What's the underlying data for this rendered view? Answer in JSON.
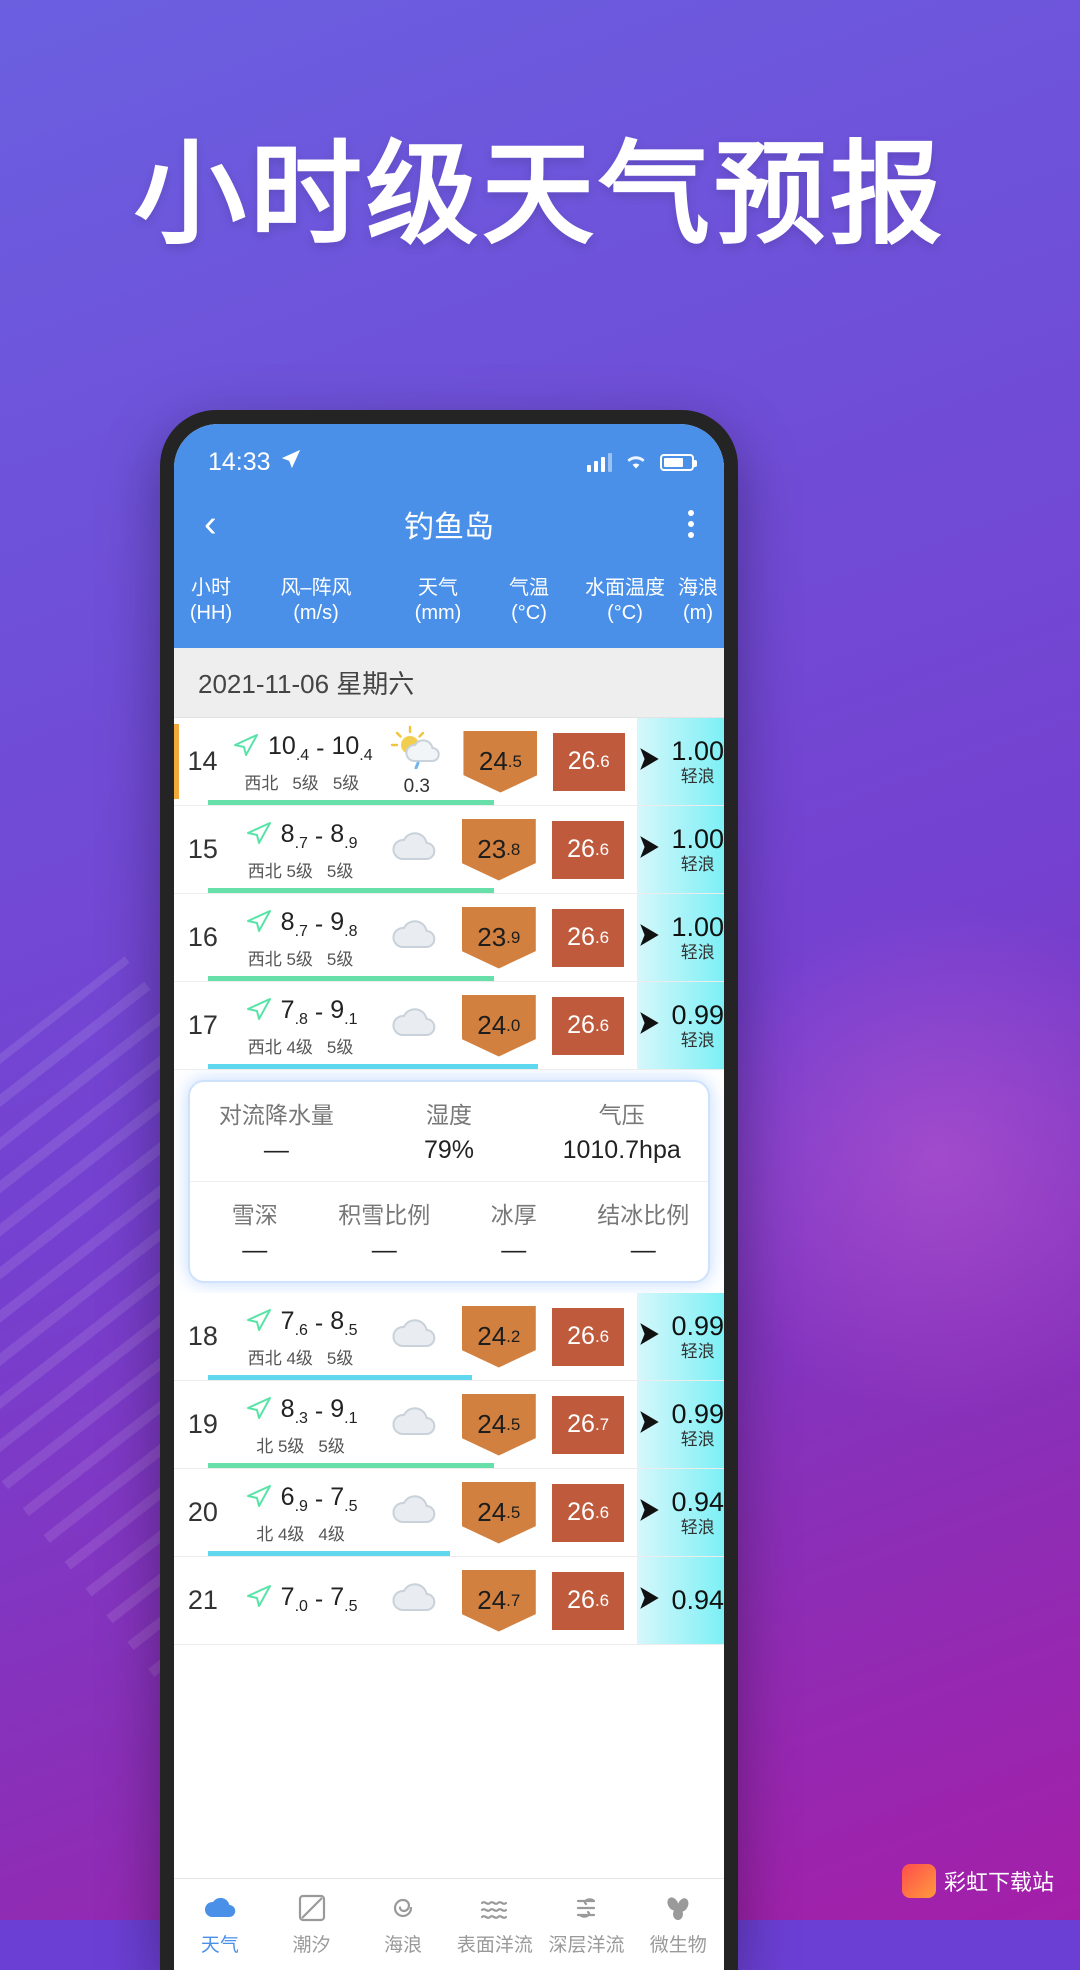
{
  "promo": {
    "headline": "小时级天气预报"
  },
  "watermark": {
    "text": "彩虹下载站",
    "logo": "rainbow-logo-icon"
  },
  "statusbar": {
    "time": "14:33",
    "location_icon": "navigation-arrow-icon",
    "signal_icon": "signal-bars-icon",
    "wifi_icon": "wifi-icon",
    "battery_icon": "battery-icon"
  },
  "appbar": {
    "back_icon": "chevron-left-icon",
    "title": "钓鱼岛",
    "menu_icon": "kebab-menu-icon"
  },
  "columns": [
    {
      "name": "小时",
      "unit": "(HH)"
    },
    {
      "name": "风–阵风",
      "unit": "(m/s)"
    },
    {
      "name": "天气",
      "unit": "(mm)"
    },
    {
      "name": "气温",
      "unit": "(°C)"
    },
    {
      "name": "水面温度",
      "unit": "(°C)"
    },
    {
      "name": "海浪",
      "unit": "(m)"
    }
  ],
  "day_header": "2021-11-06  星期六",
  "rows": [
    {
      "hour": "14",
      "wind_icon": "wind-arrow-icon",
      "wind_min": "10",
      "wind_min_dec": ".4",
      "wind_max": "10",
      "wind_max_dec": ".4",
      "dir": "西北",
      "lvl1": "5级",
      "lvl2": "5级",
      "weather_icon": "sun-cloud-rain-icon",
      "precip": "0.3",
      "temp": "24",
      "temp_dec": ".5",
      "water": "26",
      "water_dec": ".6",
      "wave": "1.00",
      "wave_label": "轻浪",
      "bar_pct": 52,
      "bar_color": "green",
      "left_marker": true
    },
    {
      "hour": "15",
      "wind_icon": "wind-arrow-icon",
      "wind_min": "8",
      "wind_min_dec": ".7",
      "wind_max": "8",
      "wind_max_dec": ".9",
      "dir": "西北 5级",
      "lvl1": "",
      "lvl2": "5级",
      "weather_icon": "cloud-icon",
      "precip": "",
      "temp": "23",
      "temp_dec": ".8",
      "water": "26",
      "water_dec": ".6",
      "wave": "1.00",
      "wave_label": "轻浪",
      "bar_pct": 52,
      "bar_color": "green",
      "left_marker": false
    },
    {
      "hour": "16",
      "wind_icon": "wind-arrow-icon",
      "wind_min": "8",
      "wind_min_dec": ".7",
      "wind_max": "9",
      "wind_max_dec": ".8",
      "dir": "西北 5级",
      "lvl1": "",
      "lvl2": "5级",
      "weather_icon": "cloud-icon",
      "precip": "",
      "temp": "23",
      "temp_dec": ".9",
      "water": "26",
      "water_dec": ".6",
      "wave": "1.00",
      "wave_label": "轻浪",
      "bar_pct": 52,
      "bar_color": "green",
      "left_marker": false
    },
    {
      "hour": "17",
      "wind_icon": "wind-arrow-icon",
      "wind_min": "7",
      "wind_min_dec": ".8",
      "wind_max": "9",
      "wind_max_dec": ".1",
      "dir": "西北 4级",
      "lvl1": "",
      "lvl2": "5级",
      "weather_icon": "cloud-icon",
      "precip": "",
      "temp": "24",
      "temp_dec": ".0",
      "water": "26",
      "water_dec": ".6",
      "wave": "0.99",
      "wave_label": "轻浪",
      "bar_pct": 60,
      "bar_color": "blue",
      "left_marker": false
    }
  ],
  "rows_after": [
    {
      "hour": "18",
      "wind_icon": "wind-arrow-icon",
      "wind_min": "7",
      "wind_min_dec": ".6",
      "wind_max": "8",
      "wind_max_dec": ".5",
      "dir": "西北 4级",
      "lvl1": "",
      "lvl2": "5级",
      "weather_icon": "cloud-icon",
      "precip": "",
      "temp": "24",
      "temp_dec": ".2",
      "water": "26",
      "water_dec": ".6",
      "wave": "0.99",
      "wave_label": "轻浪",
      "bar_pct": 48,
      "bar_color": "blue",
      "left_marker": false
    },
    {
      "hour": "19",
      "wind_icon": "wind-arrow-icon",
      "wind_min": "8",
      "wind_min_dec": ".3",
      "wind_max": "9",
      "wind_max_dec": ".1",
      "dir": "北 5级",
      "lvl1": "",
      "lvl2": "5级",
      "weather_icon": "cloud-icon",
      "precip": "",
      "temp": "24",
      "temp_dec": ".5",
      "water": "26",
      "water_dec": ".7",
      "wave": "0.99",
      "wave_label": "轻浪",
      "bar_pct": 52,
      "bar_color": "green",
      "left_marker": false
    },
    {
      "hour": "20",
      "wind_icon": "wind-arrow-icon",
      "wind_min": "6",
      "wind_min_dec": ".9",
      "wind_max": "7",
      "wind_max_dec": ".5",
      "dir": "北 4级",
      "lvl1": "",
      "lvl2": "4级",
      "weather_icon": "cloud-icon",
      "precip": "",
      "temp": "24",
      "temp_dec": ".5",
      "water": "26",
      "water_dec": ".6",
      "wave": "0.94",
      "wave_label": "轻浪",
      "bar_pct": 44,
      "bar_color": "blue",
      "left_marker": false
    },
    {
      "hour": "21",
      "wind_icon": "wind-arrow-icon",
      "wind_min": "7",
      "wind_min_dec": ".0",
      "wind_max": "7",
      "wind_max_dec": ".5",
      "dir": "",
      "lvl1": "",
      "lvl2": "",
      "weather_icon": "cloud-icon",
      "precip": "",
      "temp": "24",
      "temp_dec": ".7",
      "water": "26",
      "water_dec": ".6",
      "wave": "0.94",
      "wave_label": "",
      "bar_pct": 0,
      "bar_color": "blue",
      "left_marker": false
    }
  ],
  "panel": {
    "row1": [
      {
        "label": "对流降水量",
        "value": "—"
      },
      {
        "label": "湿度",
        "value": "79%"
      },
      {
        "label": "气压",
        "value": "1010.7hpa"
      }
    ],
    "row2": [
      {
        "label": "雪深",
        "value": "—"
      },
      {
        "label": "积雪比例",
        "value": "—"
      },
      {
        "label": "冰厚",
        "value": "—"
      },
      {
        "label": "结冰比例",
        "value": "—"
      }
    ]
  },
  "tabs": [
    {
      "label": "天气",
      "icon": "cloud-icon",
      "active": true
    },
    {
      "label": "潮汐",
      "icon": "tide-chart-icon",
      "active": false
    },
    {
      "label": "海浪",
      "icon": "wave-spiral-icon",
      "active": false
    },
    {
      "label": "表面洋流",
      "icon": "surface-current-icon",
      "active": false
    },
    {
      "label": "深层洋流",
      "icon": "deep-current-icon",
      "active": false
    },
    {
      "label": "微生物",
      "icon": "plankton-icon",
      "active": false
    }
  ],
  "colors": {
    "promo_bg": "#7540cf",
    "app_blue": "#4a90e8",
    "temp_chevron": "#d2803f",
    "water_square": "#bf5a3c",
    "wave_gradient_start": "#d7f7fb",
    "wave_gradient_end": "#7cf0f5",
    "bar_green": "#66e0a8",
    "bar_blue": "#5fd8ef"
  }
}
